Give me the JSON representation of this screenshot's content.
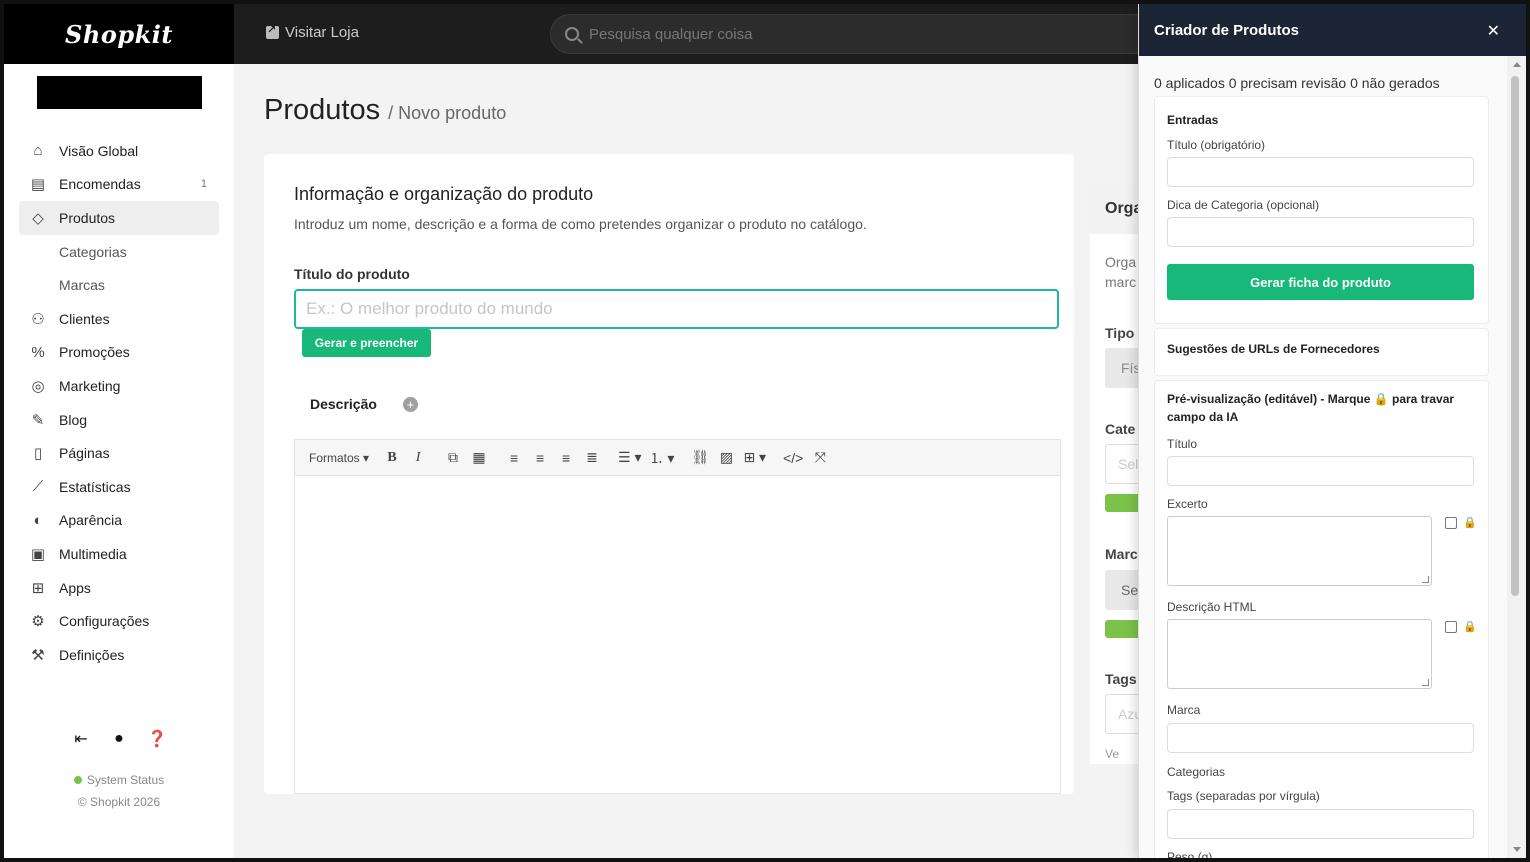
{
  "brand": {
    "logo": "Shopkit"
  },
  "topbar": {
    "visit_store": "Visitar Loja",
    "search_placeholder": "Pesquisa qualquer coisa"
  },
  "sidebar": {
    "items": [
      {
        "label": "Visão Global",
        "icon": "home-icon"
      },
      {
        "label": "Encomendas",
        "icon": "orders-icon",
        "count": "1"
      },
      {
        "label": "Produtos",
        "icon": "tag-icon"
      },
      {
        "label": "Categorias"
      },
      {
        "label": "Marcas"
      },
      {
        "label": "Clientes",
        "icon": "users-icon"
      },
      {
        "label": "Promoções",
        "icon": "discount-icon"
      },
      {
        "label": "Marketing",
        "icon": "target-icon"
      },
      {
        "label": "Blog",
        "icon": "pen-icon"
      },
      {
        "label": "Páginas",
        "icon": "page-icon"
      },
      {
        "label": "Estatísticas",
        "icon": "chart-icon"
      },
      {
        "label": "Aparência",
        "icon": "palette-icon"
      },
      {
        "label": "Multimedia",
        "icon": "images-icon"
      },
      {
        "label": "Apps",
        "icon": "apps-icon"
      },
      {
        "label": "Configurações",
        "icon": "gear-icon"
      },
      {
        "label": "Definições",
        "icon": "wrench-icon"
      }
    ],
    "status": "System Status",
    "copyright": "© Shopkit 2026"
  },
  "page": {
    "title": "Produtos",
    "breadcrumb": "/ Novo produto"
  },
  "product_card": {
    "heading": "Informação e organização do produto",
    "description": "Introduz um nome, descrição e a forma de como pretendes organizar o produto no catálogo.",
    "title_label": "Título do produto",
    "title_placeholder": "Ex.: O melhor produto do mundo",
    "title_value": "",
    "generate_fill": "Gerar e preencher",
    "tab_description": "Descrição",
    "tab_add": "+",
    "toolbar_formats": "Formatos"
  },
  "org_card": {
    "header": "Orga",
    "text1": "Orga",
    "text2": "marc",
    "tipo": "Tipo",
    "tipo_value": "Fís",
    "cate": "Cate",
    "cate_input": "Sel",
    "marc": "Marc",
    "marc_value": "Se",
    "tags": "Tags",
    "tags_input": "Azu",
    "tags_hint": "Ve"
  },
  "panel": {
    "title": "Criador de Produtos",
    "close": "✕",
    "summary": "0 aplicados 0 precisam revisão 0 não gerados",
    "entradas": {
      "heading": "Entradas",
      "title_label": "Título (obrigatório)",
      "title_value": "",
      "category_label": "Dica de Categoria (opcional)",
      "category_value": "",
      "generate_button": "Gerar ficha do produto"
    },
    "suppliers": {
      "heading": "Sugestões de URLs de Fornecedores"
    },
    "preview": {
      "heading": "Pré-visualização (editável) - Marque 🔒 para travar campo da IA",
      "title_label": "Título",
      "excerpt_label": "Excerto",
      "html_label": "Descrição HTML",
      "brand_label": "Marca",
      "categories_label": "Categorias",
      "tags_label": "Tags (separadas por vírgula)",
      "weight_label": "Peso (g)",
      "lock": "🔒"
    }
  },
  "colors": {
    "accent": "#18b878",
    "focus": "#1fb89a",
    "panel_header": "#1c2535"
  }
}
